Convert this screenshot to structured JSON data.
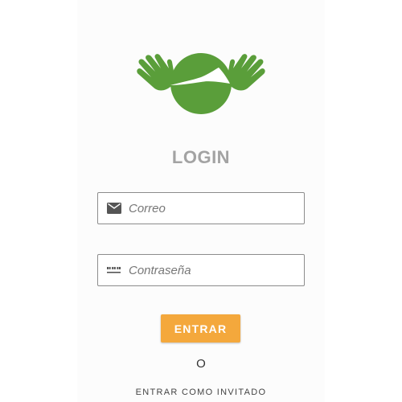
{
  "header": {
    "logo_icon": "hands-globe-logo",
    "title": "LOGIN"
  },
  "form": {
    "email": {
      "icon": "envelope-icon",
      "placeholder": "Correo",
      "value": ""
    },
    "password": {
      "icon": "password-dots-icon",
      "placeholder": "Contraseña",
      "value": ""
    },
    "submit_label": "ENTRAR"
  },
  "separator": "O",
  "guest_label": "ENTRAR COMO INVITADO",
  "colors": {
    "logo_green": "#5a9e3a",
    "button_orange": "#f4a83c",
    "title_gray": "#a3a3a3"
  }
}
